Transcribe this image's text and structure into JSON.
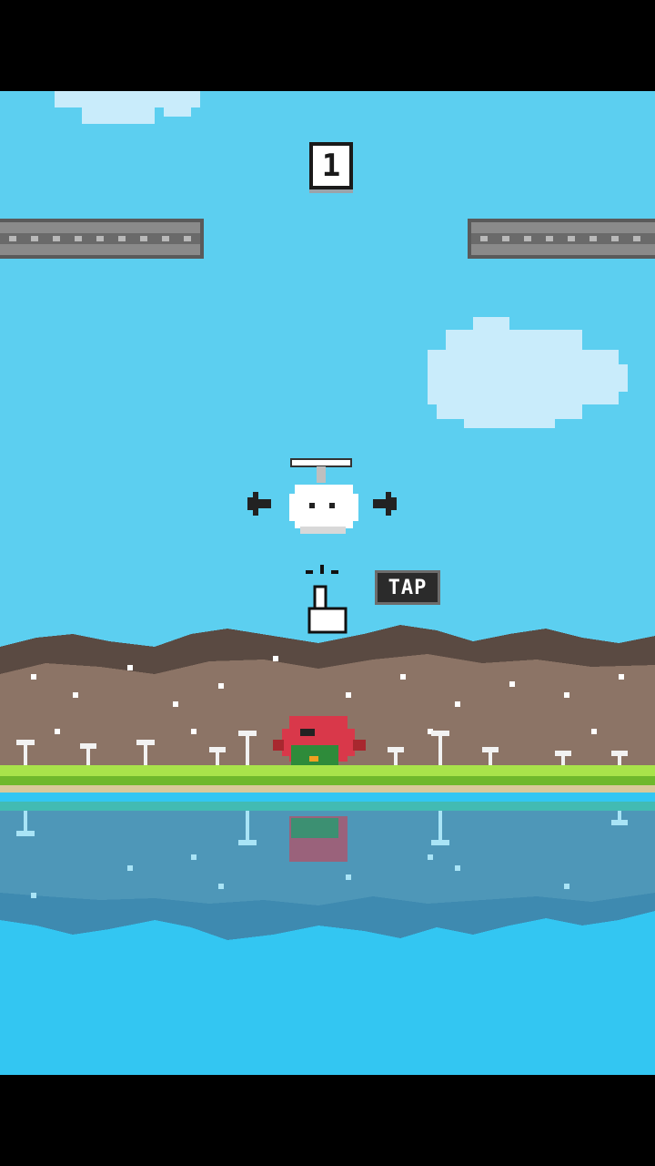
{
  "game": {
    "title": "",
    "score": "1",
    "tutorial": {
      "tap_label": "TAP"
    }
  },
  "colors": {
    "sky": "#5ccff0",
    "cloud": "#c9ecfb",
    "girder": "#7d7d7d",
    "hill_dark": "#5a4a42",
    "hill": "#8c7466",
    "grass": "#a8e34b",
    "water": "#33c6f2",
    "bird_red": "#d9384a",
    "bird_green": "#2e8b3a"
  },
  "icons": {
    "score": "score-box",
    "player": "propeller-cloud-character",
    "left": "arrow-left-icon",
    "right": "arrow-right-icon",
    "hand": "pointing-hand-icon",
    "enemy": "red-bird-enemy"
  }
}
